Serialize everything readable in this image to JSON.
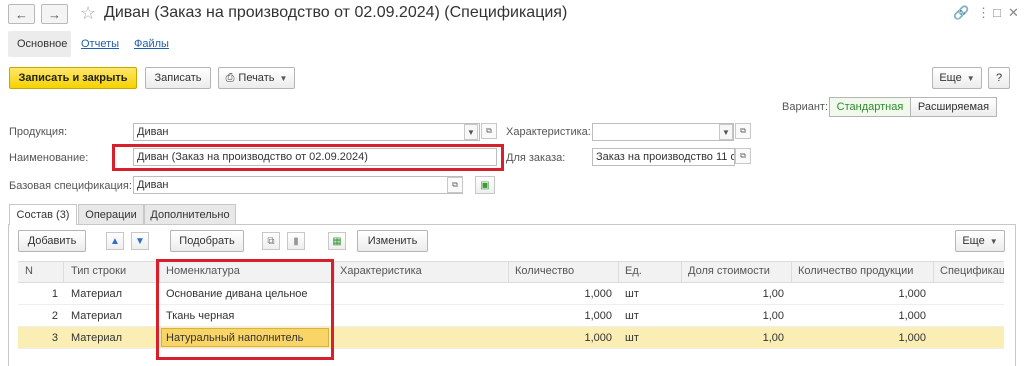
{
  "window": {
    "title": "Диван (Заказ на производство  от 02.09.2024) (Спецификация)"
  },
  "sections": {
    "main": "Основное",
    "reports": "Отчеты",
    "files": "Файлы"
  },
  "toolbar": {
    "save_close": "Записать и закрыть",
    "save": "Записать",
    "print": "Печать",
    "more": "Еще",
    "help": "?"
  },
  "variant": {
    "label": "Вариант:",
    "options": [
      "Стандартная",
      "Расширяемая"
    ],
    "selected": "Стандартная"
  },
  "form": {
    "product_label": "Продукция:",
    "product_value": "Диван",
    "characteristic_label": "Характеристика:",
    "characteristic_value": "",
    "name_label": "Наименование:",
    "name_value": "Диван (Заказ на производство  от 02.09.2024)",
    "order_label": "Для заказа:",
    "order_value": "Заказ на производство 11 о",
    "base_spec_label": "Базовая спецификация:",
    "base_spec_value": "Диван"
  },
  "tabs": [
    "Состав (3)",
    "Операции",
    "Дополнительно"
  ],
  "table_toolbar": {
    "add": "Добавить",
    "pick": "Подобрать",
    "change": "Изменить",
    "more": "Еще"
  },
  "table": {
    "columns": [
      "N",
      "Тип строки",
      "Номенклатура",
      "Характеристика",
      "Количество",
      "Ед.",
      "Доля стоимости",
      "Количество продукции",
      "Спецификац"
    ],
    "rows": [
      {
        "n": "1",
        "type": "Материал",
        "item": "Основание дивана цельное",
        "char": "",
        "qty": "1,000",
        "unit": "шт",
        "share": "1,00",
        "prod_qty": "1,000"
      },
      {
        "n": "2",
        "type": "Материал",
        "item": "Ткань черная",
        "char": "",
        "qty": "1,000",
        "unit": "шт",
        "share": "1,00",
        "prod_qty": "1,000"
      },
      {
        "n": "3",
        "type": "Материал",
        "item": "Натуральный наполнитель",
        "char": "",
        "qty": "1,000",
        "unit": "шт",
        "share": "1,00",
        "prod_qty": "1,000"
      }
    ]
  },
  "colors": {
    "accent_yellow": "#f5d200",
    "highlight_red": "#d8202c",
    "selected_row": "#fbeeb4",
    "variant_green": "#2e8b2e"
  }
}
